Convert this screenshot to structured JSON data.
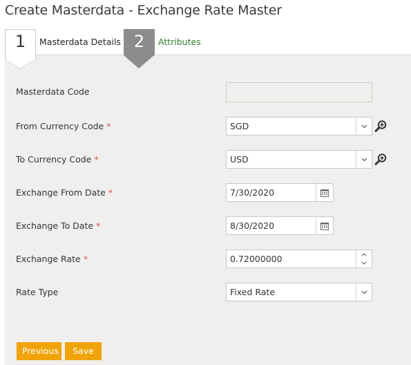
{
  "page": {
    "title": "Create Masterdata - Exchange Rate Master"
  },
  "wizard": {
    "steps": [
      {
        "number": "1",
        "label": "Masterdata Details"
      },
      {
        "number": "2",
        "label": "Attributes"
      }
    ]
  },
  "form": {
    "masterdata_code": {
      "label": "Masterdata Code",
      "value": ""
    },
    "from_currency": {
      "label": "From Currency Code",
      "required_mark": "*",
      "value": "SGD"
    },
    "to_currency": {
      "label": "To Currency Code",
      "required_mark": "*",
      "value": "USD"
    },
    "from_date": {
      "label": "Exchange From Date",
      "required_mark": "*",
      "value": "7/30/2020"
    },
    "to_date": {
      "label": "Exchange To Date",
      "required_mark": "*",
      "value": "8/30/2020"
    },
    "rate": {
      "label": "Exchange Rate",
      "required_mark": "*",
      "value": "0.72000000"
    },
    "rate_type": {
      "label": "Rate Type",
      "value": "Fixed Rate"
    }
  },
  "buttons": {
    "previous": "Previous",
    "save": "Save"
  },
  "colors": {
    "accent": "#f0a30a",
    "link": "#2e7d2e",
    "required": "#d9534f",
    "panel": "#f0efed"
  },
  "icons": {
    "dropdown": "chevron-down-icon",
    "calendar": "calendar-icon",
    "spinner": "spinner-arrows-icon",
    "lookup": "search-plus-icon"
  }
}
